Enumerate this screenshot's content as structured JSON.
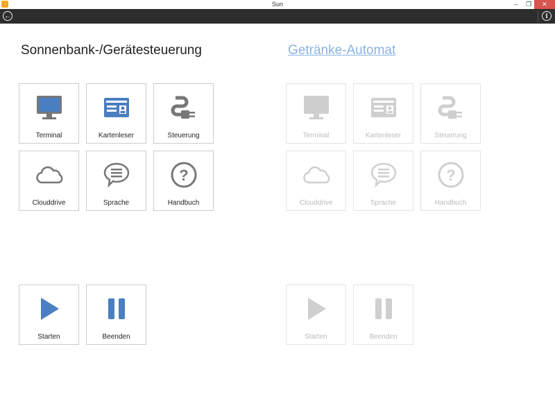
{
  "window": {
    "title": "Sun"
  },
  "left": {
    "heading": "Sonnenbank-/Gerätesteuerung",
    "tiles": [
      "Terminal",
      "Kartenleser",
      "Steuerung",
      "Clouddrive",
      "Sprache",
      "Handbuch"
    ],
    "actions": [
      "Starten",
      "Beenden"
    ]
  },
  "right": {
    "heading": "Getränke-Automat",
    "tiles": [
      "Terminal",
      "Kartenleser",
      "Steuerung",
      "Clouddrive",
      "Sprache",
      "Handbuch"
    ],
    "actions": [
      "Starten",
      "Beenden"
    ]
  },
  "colors": {
    "accent": "#4a7fc1",
    "icon_gray": "#777777",
    "appbar": "#2d2d2d",
    "close": "#d9534f"
  }
}
